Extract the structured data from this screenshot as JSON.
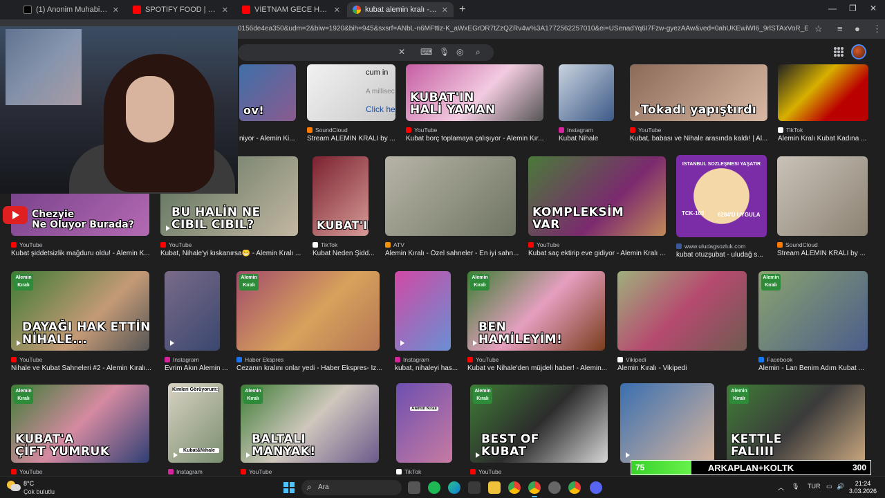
{
  "browser": {
    "tabs": [
      {
        "title": "(1) Anonim Muhabir on X: \"İki k",
        "icon": "x-logo-icon",
        "favicon": "x"
      },
      {
        "title": "SPOTİFY FOOD | Madara Olduk",
        "icon": "youtube-icon",
        "favicon": "yt"
      },
      {
        "title": "VİETNAM GECE HAYATI BENİ Ç",
        "icon": "youtube-icon",
        "favicon": "yt"
      },
      {
        "title": "kubat alemin kralı - Google'da A",
        "icon": "google-icon",
        "favicon": "g",
        "active": true
      }
    ],
    "url": "0156de4ea350&udm=2&biw=1920&bih=945&sxsrf=ANbL-n6MFttiz-K_aWxEGrDR7tZzQZRv4w%3A1772562257010&ei=USenadYq6I7Fzw-gyezAAw&ved=0ahUKEwiWI6_9rlSTAxVoR_EDHaAkGzgQ4d..."
  },
  "results": [
    {
      "source": "",
      "title": "niyor - Alemin Ki...",
      "overlay": "ov!",
      "src_color": "#ff0000"
    },
    {
      "source": "SoundCloud",
      "title": "Stream ALEMIN KRALI by ...",
      "overlay": "",
      "text1": "cum in",
      "text2": "A millisec",
      "text3": "Click her",
      "src_color": "#ff7a00"
    },
    {
      "source": "YouTube",
      "title": "Kubat borç toplamaya çalışıyor - Alemin Kır...",
      "overlay": "KUBAT'IN\nHALİ YAMAN",
      "src_color": "#ff0000"
    },
    {
      "source": "Instagram",
      "title": "Kubat Nihale",
      "overlay": "",
      "src_color": "#d6249f"
    },
    {
      "source": "YouTube",
      "title": "Kubat, babası ve Nihale arasında kaldı! | Al...",
      "overlay": "Tokadı yapıştırdı",
      "src_color": "#ff0000"
    },
    {
      "source": "TikTok",
      "title": "Alemin Kralı Kubat Kadına ...",
      "overlay": "",
      "src_color": "#ffffff"
    },
    {
      "source": "YouTube",
      "title": "Kubat şiddetsizlik mağduru oldu! - Alemin K...",
      "overlay": "",
      "src_color": "#ff0000"
    },
    {
      "source": "YouTube",
      "title": "Kubat, Nihale'yi kıskanırsa😁 - Alemin Kralı ...",
      "overlay": "BU HALİN NE\nCIBIL CIBIL?",
      "src_color": "#ff0000"
    },
    {
      "source": "TikTok",
      "title": "Kubat Neden Şidd...",
      "overlay": "KUBAT'IN",
      "src_color": "#ffffff"
    },
    {
      "source": "ATV",
      "title": "Alemin Kıralı - Özel sahneler - En iyi sahn...",
      "overlay": "",
      "src_color": "#f39200"
    },
    {
      "source": "YouTube",
      "title": "Kubat saç ektirip eve gidiyor - Alemin Kralı ...",
      "overlay": "KOMPLEKSİM\nVAR",
      "src_color": "#ff0000"
    },
    {
      "source": "www.uludagsozluk.com",
      "title": "kubat otuzşubat - uludağ s...",
      "overlay": "",
      "badge_top": "İSTANBUL SÖZLEŞMESİ YAŞATIR",
      "badge_left": "TCK-103",
      "badge_right": "6284'Ü UYGULA",
      "src_color": "#3b5998"
    },
    {
      "source": "SoundCloud",
      "title": "Stream ALEMIN KRALI by ...",
      "overlay": "",
      "src_color": "#ff7a00"
    },
    {
      "source": "YouTube",
      "title": "Nihale ve Kubat Sahneleri #2 - Alemin Kıralı...",
      "overlay": "DAYAĞI HAK ETTİN\nNİHALE...",
      "src_color": "#ff0000"
    },
    {
      "source": "Instagram",
      "title": "Evrim Akın Alemin ...",
      "overlay": "",
      "src_color": "#d6249f"
    },
    {
      "source": "Haber Ekspres",
      "title": "Cezanın kralını onlar yedi - Haber Ekspres- İz...",
      "overlay": "",
      "src_color": "#1a73e8"
    },
    {
      "source": "Instagram",
      "title": "kubat, nihaleyi has...",
      "overlay": "",
      "src_color": "#d6249f"
    },
    {
      "source": "YouTube",
      "title": "Kubat ve Nihale'den müjdeli haber! - Alemin...",
      "overlay": "BEN\nHAMİLEYİM!",
      "src_color": "#ff0000"
    },
    {
      "source": "Vikipedi",
      "title": "Alemin Kıralı - Vikipedi",
      "overlay": "",
      "src_color": "#ffffff"
    },
    {
      "source": "Facebook",
      "title": "Alemin - Lan Benim Adım Kubat ...",
      "overlay": "",
      "src_color": "#1877f2"
    },
    {
      "source": "YouTube",
      "title": "",
      "overlay": "KUBAT'A\nÇİFT YUMRUK",
      "src_color": "#ff0000"
    },
    {
      "source": "Instagram",
      "title": "",
      "overlay": "",
      "top_label": "Kimleri Görüyorum:)",
      "bottom_label": "Kubat&Nihale",
      "src_color": "#d6249f"
    },
    {
      "source": "YouTube",
      "title": "",
      "overlay": "BALTALI\nMANYAK!",
      "src_color": "#ff0000"
    },
    {
      "source": "TikTok",
      "title": "",
      "overlay": "",
      "mid_label": "Alemin Kıralı",
      "src_color": "#ffffff"
    },
    {
      "source": "YouTube",
      "title": "",
      "overlay": "BEST OF\nKUBAT",
      "src_color": "#ff0000"
    },
    {
      "source": "",
      "title": "",
      "overlay": "",
      "src_color": "#d6249f"
    },
    {
      "source": "",
      "title": "",
      "overlay": "KETTLE\nFALIIII",
      "src_color": "#ff0000"
    }
  ],
  "badge_text": "Alemin\nKıralı",
  "webcam": {
    "caption_line1": "Chezyie",
    "caption_line2": "Ne Oluyor Burada?"
  },
  "progress_overlay": {
    "current": "75",
    "label": "ARKAPLAN+KOLTK",
    "target": "300",
    "fraction": 0.25
  },
  "taskbar": {
    "temperature": "8°C",
    "weather": "Çok bulutlu",
    "search_placeholder": "Ara",
    "language": "TUR",
    "time": "21:24",
    "date": "3.03.2026"
  }
}
